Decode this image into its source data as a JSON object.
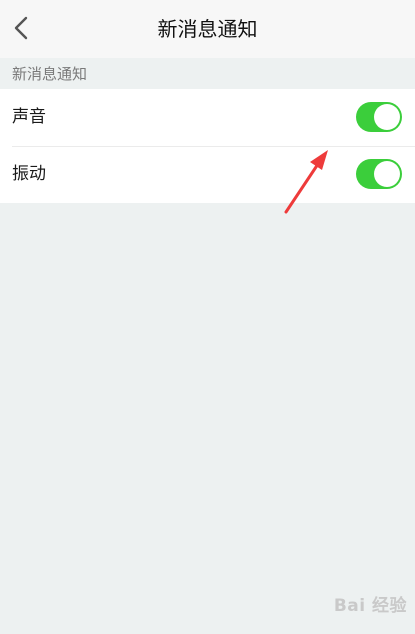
{
  "nav": {
    "title": "新消息通知",
    "back_icon": "chevron-left-icon"
  },
  "section": {
    "header": "新消息通知"
  },
  "settings": [
    {
      "label": "声音",
      "enabled": true
    },
    {
      "label": "振动",
      "enabled": true
    }
  ],
  "colors": {
    "toggle_on": "#3bce3b",
    "annotation_arrow": "#ee3b3b"
  },
  "watermark": {
    "text": "Bai 经验"
  }
}
